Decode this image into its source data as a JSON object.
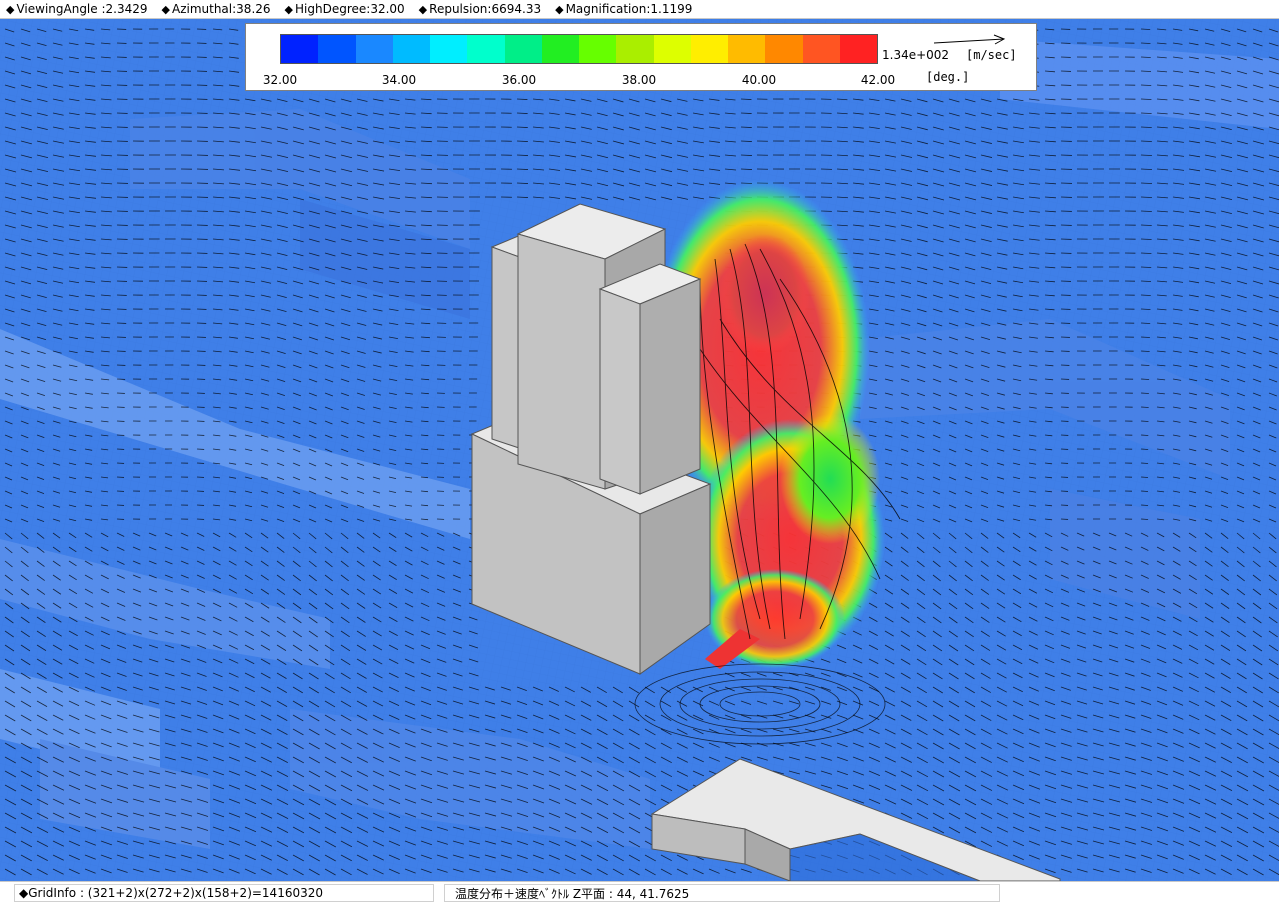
{
  "params": [
    {
      "key": "ViewingAngle",
      "value": "2.3429"
    },
    {
      "key": "Azimuthal",
      "value": "38.26"
    },
    {
      "key": "HighDegree",
      "value": "32.00"
    },
    {
      "key": "Repulsion",
      "value": "6694.33"
    },
    {
      "key": "Magnification",
      "value": "1.1199"
    }
  ],
  "legend": {
    "colors": [
      "#0022ff",
      "#0055ff",
      "#1a88ff",
      "#00bbff",
      "#00eeff",
      "#00ffcc",
      "#00ee88",
      "#22ee22",
      "#66ff00",
      "#aaee00",
      "#ddff00",
      "#ffee00",
      "#ffbb00",
      "#ff8800",
      "#ff5522",
      "#ff2222"
    ],
    "ticks": [
      "32.00",
      "34.00",
      "36.00",
      "38.00",
      "40.00",
      "42.00"
    ],
    "vector_scale": "1.34e+002",
    "vector_unit": "[m/sec]",
    "temp_unit": "[deg.]"
  },
  "status": {
    "grid_info": "◆GridInfo : (321+2)x(272+2)x(158+2)=14160320",
    "plane_info": "温度分布＋速度ﾍﾞｸﾄﾙ Z平面 : 44,  41.7625"
  }
}
